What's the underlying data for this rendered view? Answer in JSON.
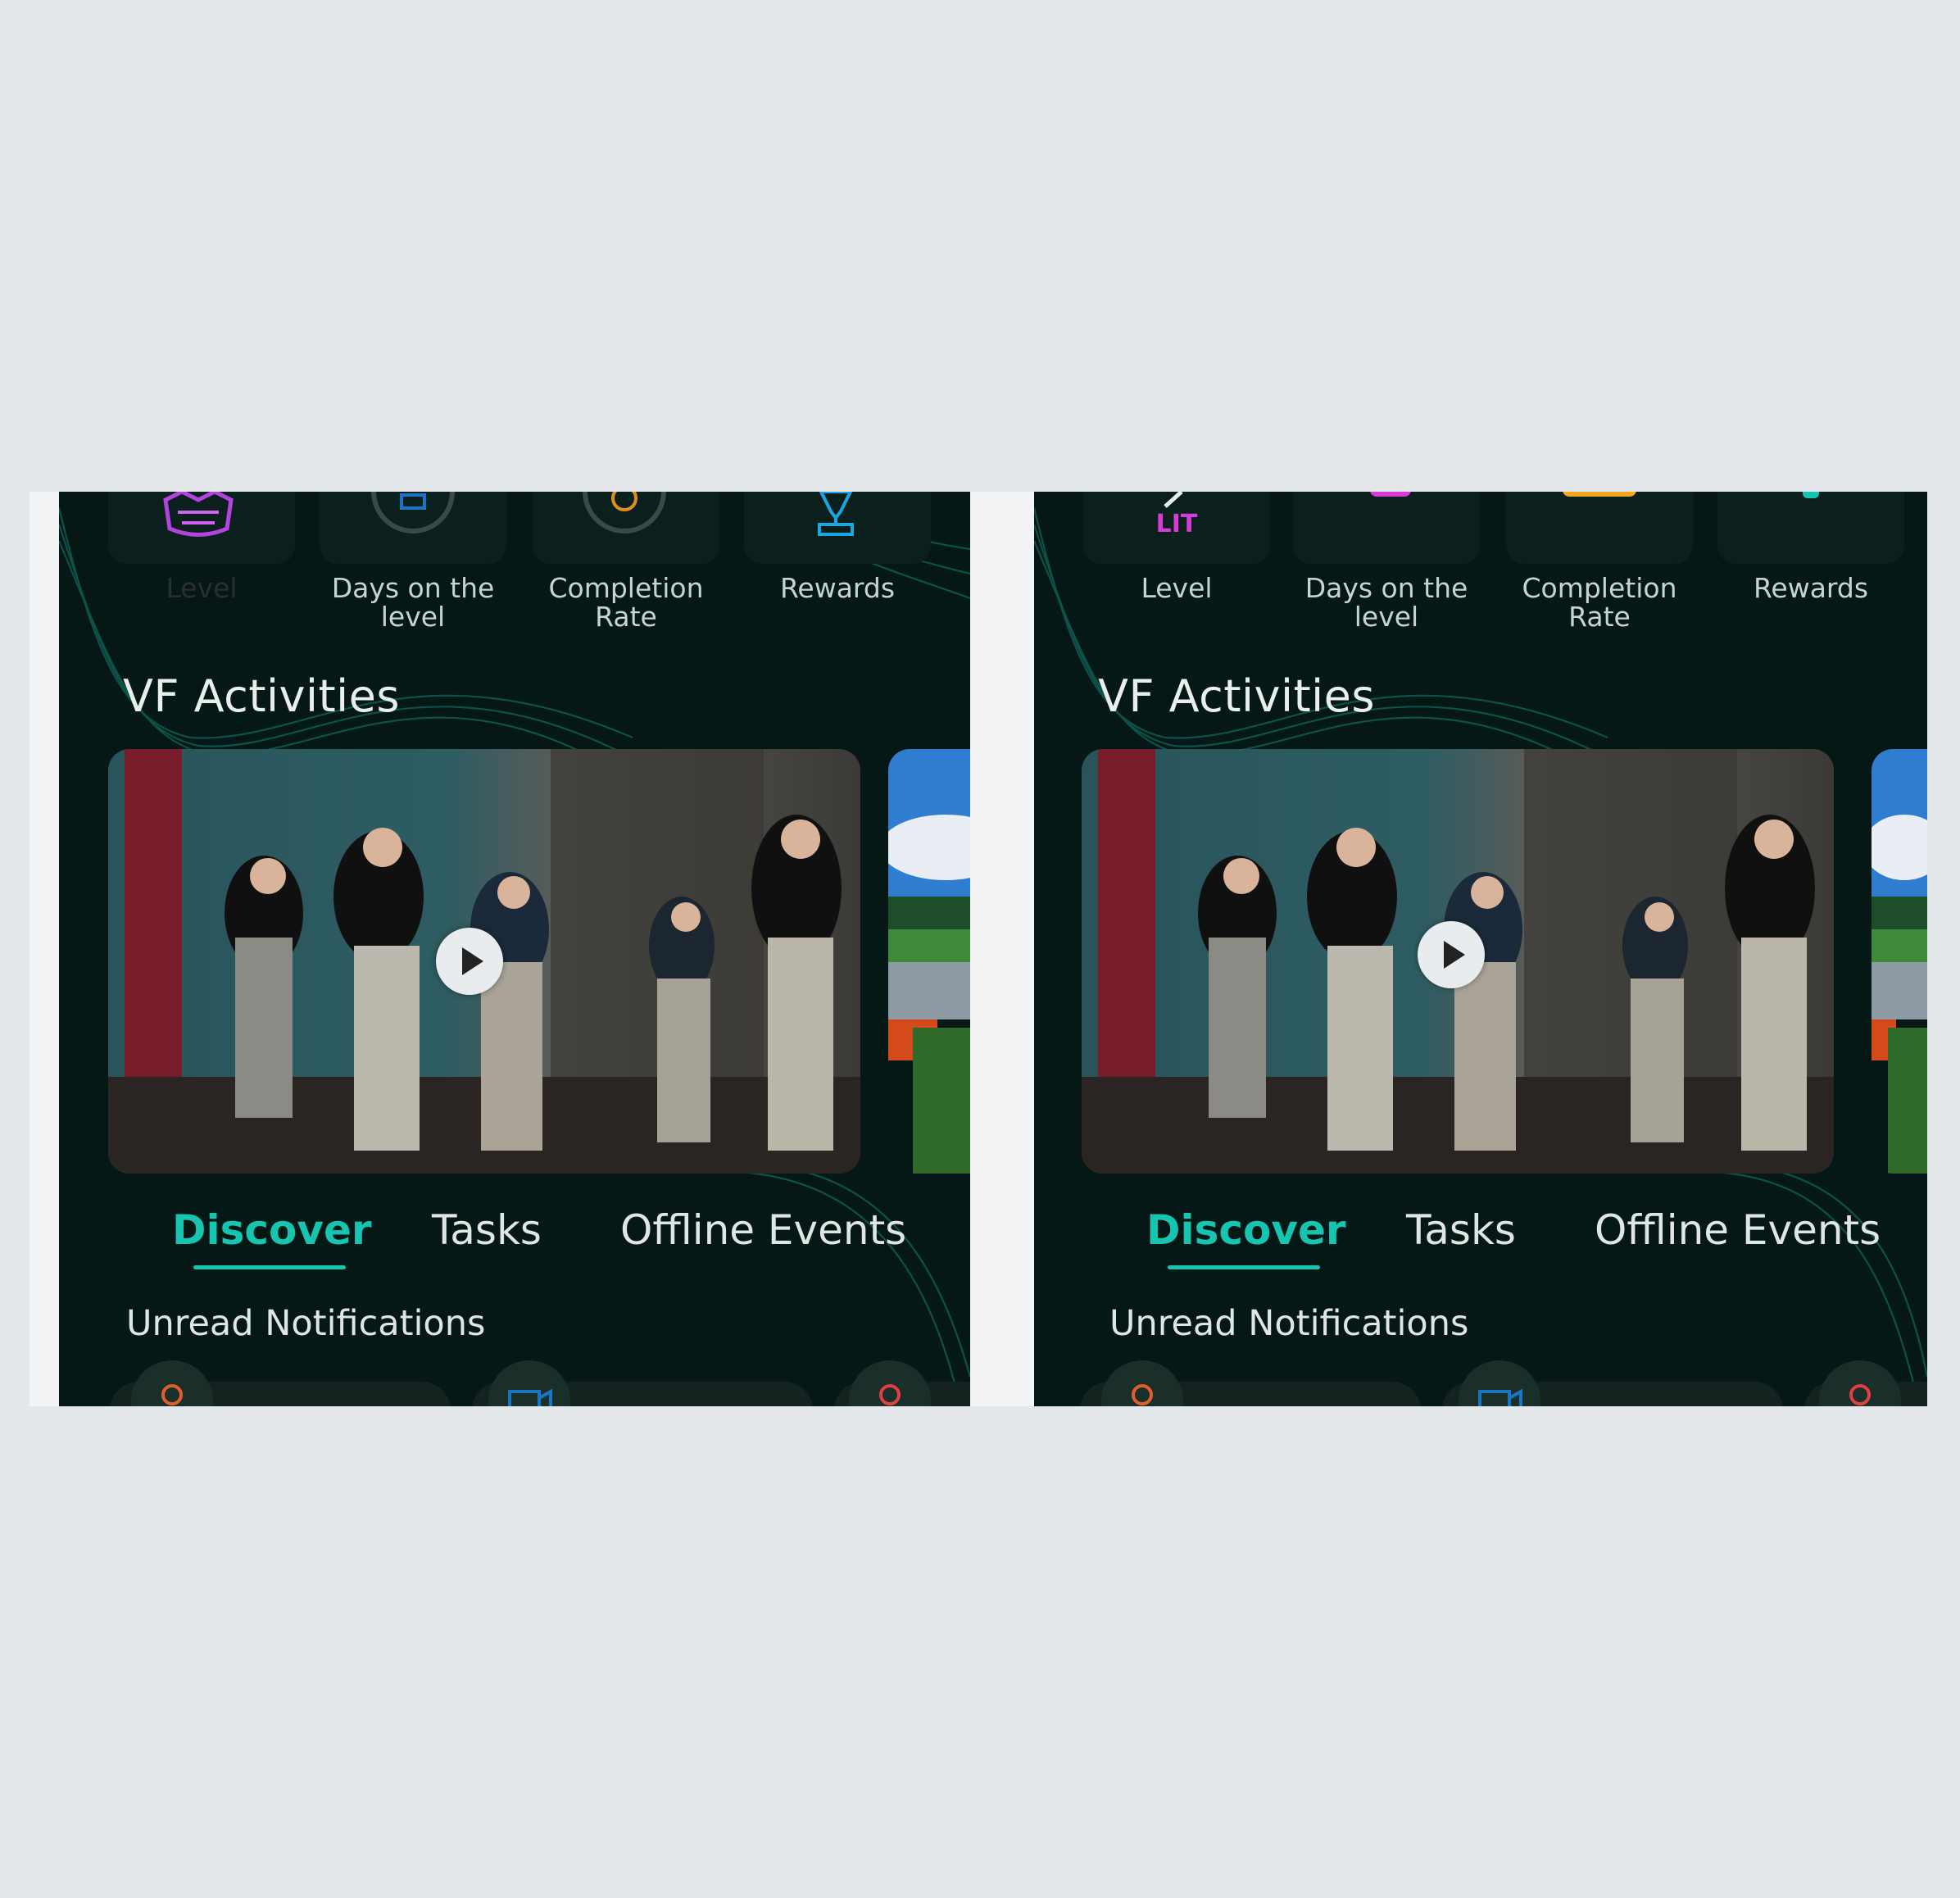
{
  "left": {
    "stats": [
      {
        "label": "Level"
      },
      {
        "label": "Days on the level"
      },
      {
        "label": "Completion Rate"
      },
      {
        "label": "Rewards"
      }
    ],
    "section_title": "VF Activities",
    "tabs": [
      {
        "label": "Discover",
        "active": true
      },
      {
        "label": "Tasks",
        "active": false
      },
      {
        "label": "Offline Events",
        "active": false
      }
    ],
    "notifications_title": "Unread Notifications"
  },
  "right": {
    "stats": [
      {
        "label": "Level",
        "value": "LIT"
      },
      {
        "label": "Days on the level"
      },
      {
        "label": "Completion Rate"
      },
      {
        "label": "Rewards"
      }
    ],
    "section_title": "VF Activities",
    "tabs": [
      {
        "label": "Discover",
        "active": true
      },
      {
        "label": "Tasks",
        "active": false
      },
      {
        "label": "Offline Events",
        "active": false
      }
    ],
    "notifications_title": "Unread Notifications"
  },
  "colors": {
    "accent": "#17c4b0",
    "background": "#061816",
    "level_badge": "#d63cd6",
    "completion": "#f0a81e",
    "rewards": "#1aa6e0"
  }
}
